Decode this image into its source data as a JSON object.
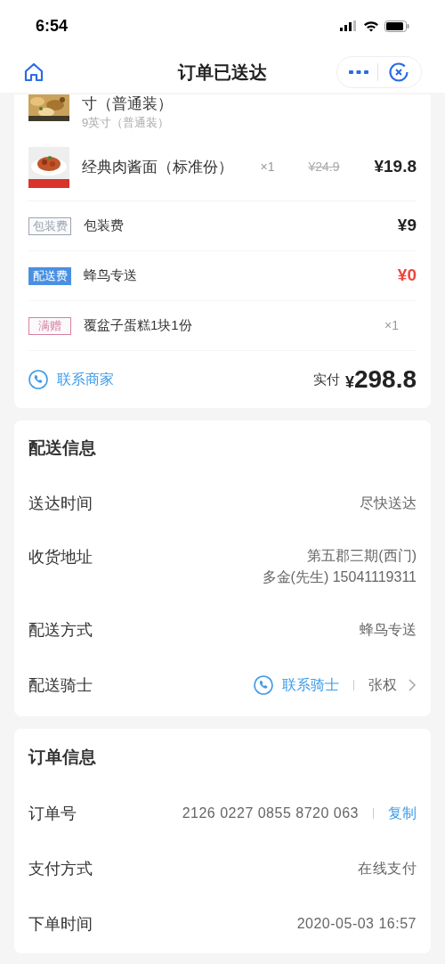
{
  "status_bar": {
    "time": "6:54"
  },
  "nav": {
    "title": "订单已送达"
  },
  "order_card": {
    "items": [
      {
        "name": "寸（普通装）",
        "spec": "9英寸（普通装）"
      },
      {
        "name": "经典肉酱面（标准份）",
        "quantity": "×1",
        "original_price": "¥24.9",
        "price": "¥19.8"
      }
    ],
    "fees": [
      {
        "kind": "fee",
        "tag": "包装费",
        "filled": false,
        "color": "#9aa3b2",
        "label": "包装费",
        "amount": "¥9",
        "highlight": false
      },
      {
        "kind": "fee",
        "tag": "配送费",
        "filled": true,
        "color": "#4a90e2",
        "label": "蜂鸟专送",
        "amount": "¥0",
        "highlight": true
      },
      {
        "kind": "gift",
        "tag": "满赠",
        "filled": false,
        "color": "#d77fa1",
        "label": "覆盆子蛋糕1块1份",
        "quantity": "×1"
      }
    ],
    "contact": "联系商家",
    "paid_label": "实付",
    "paid_currency": "¥",
    "paid_amount": "298.8"
  },
  "delivery_card": {
    "title": "配送信息",
    "rows": [
      {
        "kind": "text",
        "label": "送达时间",
        "lines": [
          "尽快送达"
        ]
      },
      {
        "kind": "text",
        "label": "收货地址",
        "lines": [
          "第五郡三期(西门)",
          "多金(先生) 15041119311"
        ]
      },
      {
        "kind": "text",
        "label": "配送方式",
        "lines": [
          "蜂鸟专送"
        ]
      },
      {
        "kind": "rider",
        "label": "配送骑士",
        "contact": "联系骑士",
        "name": "张权"
      }
    ]
  },
  "order_info_card": {
    "title": "订单信息",
    "rows": [
      {
        "kind": "copy",
        "label": "订单号",
        "value": "2126 0227 0855 8720 063",
        "action": "复制"
      },
      {
        "kind": "text",
        "label": "支付方式",
        "value": "在线支付"
      },
      {
        "kind": "text",
        "label": "下单时间",
        "value": "2020-05-03 16:57"
      }
    ]
  }
}
